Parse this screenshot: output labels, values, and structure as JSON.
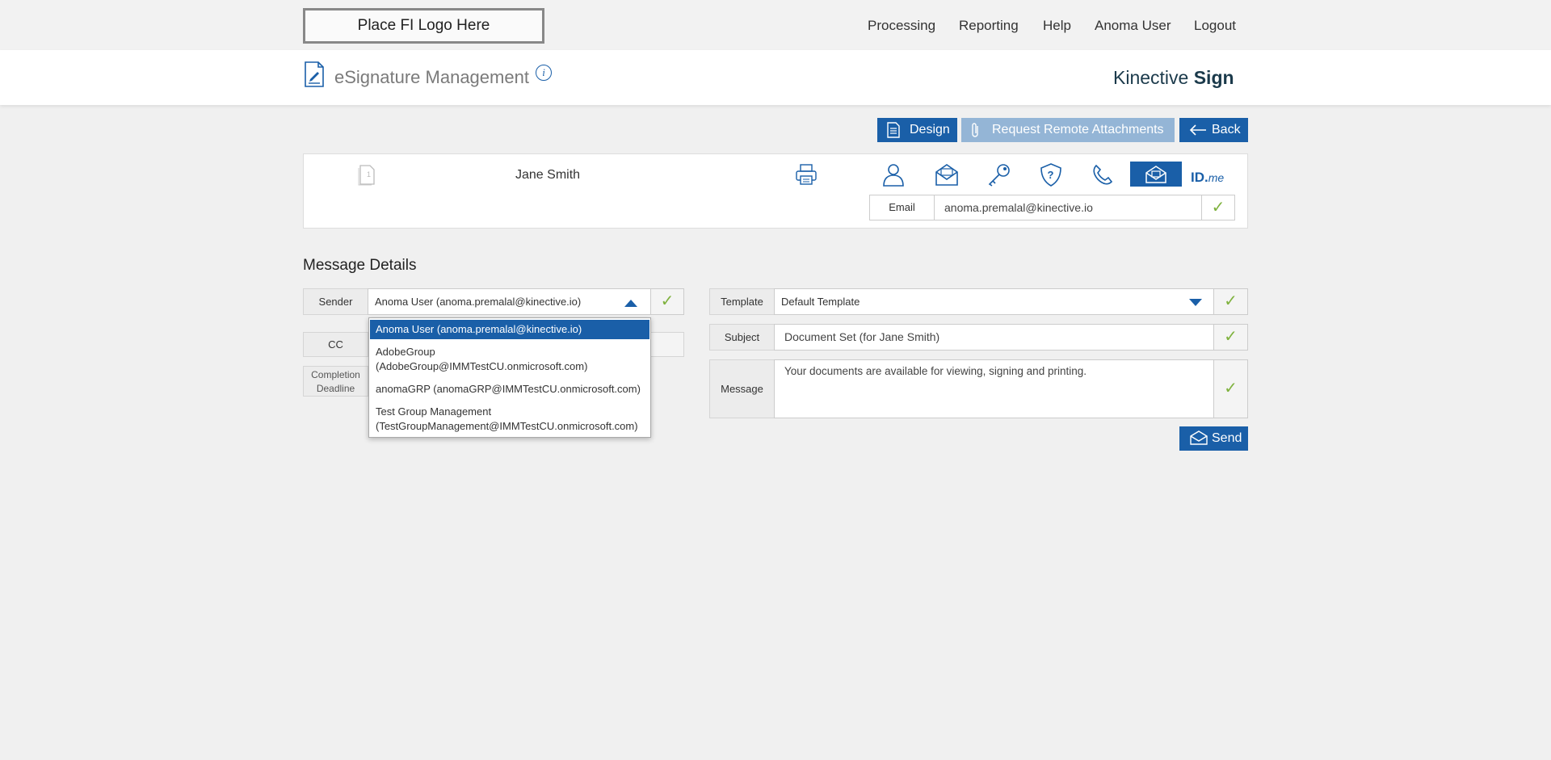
{
  "topbar": {
    "logo_text": "Place FI Logo Here",
    "nav": [
      "Processing",
      "Reporting",
      "Help",
      "Anoma User",
      "Logout"
    ]
  },
  "header": {
    "title": "eSignature Management",
    "brand_light": "Kinective",
    "brand_bold": "Sign"
  },
  "actions": {
    "design": "Design",
    "remote_attachments": "Request Remote Attachments",
    "back": "Back"
  },
  "signer": {
    "name": "Jane Smith",
    "auth_icons": [
      "person-icon",
      "email-envelope-icon",
      "key-icon",
      "question-shield-icon",
      "phone-icon",
      "secure-email-icon"
    ],
    "idme_text": "ID.",
    "idme_suffix": "me",
    "email_label": "Email",
    "email_value": "anoma.premalal@kinective.io"
  },
  "message_details": {
    "title": "Message Details",
    "sender_label": "Sender",
    "sender_value": "Anoma User (anoma.premalal@kinective.io)",
    "cc_label": "CC",
    "deadline_label_1": "Completion",
    "deadline_label_2": "Deadline",
    "template_label": "Template",
    "template_value": "Default Template",
    "subject_label": "Subject",
    "subject_value": "Document Set (for Jane Smith)",
    "message_label": "Message",
    "message_value": "Your documents are available for viewing, signing and printing.",
    "send": "Send"
  },
  "sender_options": [
    {
      "line1": "Anoma User (anoma.premalal@kinective.io)",
      "line2": ""
    },
    {
      "line1": "AdobeGroup",
      "line2": "(AdobeGroup@IMMTestCU.onmicrosoft.com)"
    },
    {
      "line1": "anomaGRP (anomaGRP@IMMTestCU.onmicrosoft.com)",
      "line2": ""
    },
    {
      "line1": "Test Group Management",
      "line2": "(TestGroupManagement@IMMTestCU.onmicrosoft.com)"
    }
  ],
  "colors": {
    "primary": "#1a5fa8",
    "disabled_button": "#94b5d6",
    "check": "#7fb23e"
  }
}
